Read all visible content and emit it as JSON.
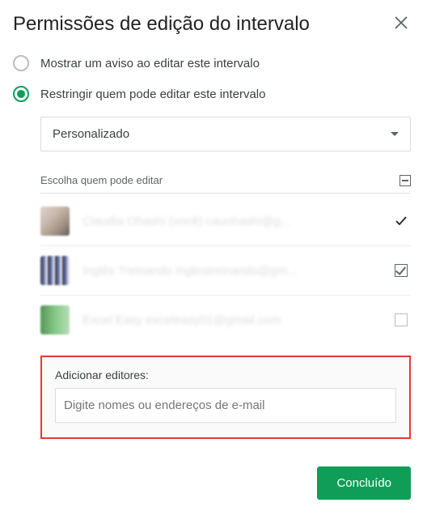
{
  "dialog": {
    "title": "Permissões de edição do intervalo"
  },
  "options": {
    "show_warning": "Mostrar um aviso ao editar este intervalo",
    "restrict": "Restringir quem pode editar este intervalo"
  },
  "dropdown": {
    "selected": "Personalizado"
  },
  "editors_section": {
    "header": "Escolha quem pode editar"
  },
  "users": [
    {
      "display": "Claudia Ohashi (você)  cauohashi@g...",
      "state": "owner"
    },
    {
      "display": "Inglês Treinando  inglestreinando@gm...",
      "state": "checked"
    },
    {
      "display": "Excel Easy  exceleasy01@gmail.com",
      "state": "unchecked"
    }
  ],
  "add_editors": {
    "label": "Adicionar editores:",
    "placeholder": "Digite nomes ou endereços de e-mail"
  },
  "footer": {
    "done": "Concluído"
  }
}
